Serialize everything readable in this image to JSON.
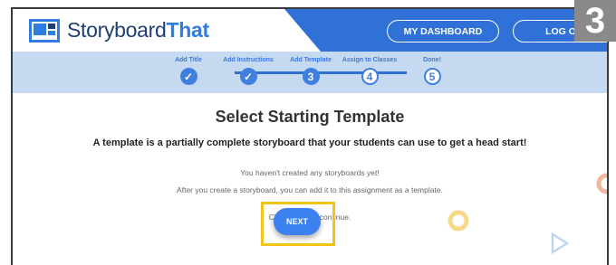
{
  "brand": {
    "name_part1": "Storyboard",
    "name_part2": "That"
  },
  "header": {
    "dashboard_label": "MY DASHBOARD",
    "logout_label": "LOG OUT",
    "step_badge": "3"
  },
  "progress": {
    "steps": [
      {
        "label": "Add Title",
        "state": "done",
        "marker": "✓"
      },
      {
        "label": "Add Instructions",
        "state": "done",
        "marker": "✓"
      },
      {
        "label": "Add Template",
        "state": "current",
        "marker": "3"
      },
      {
        "label": "Assign to Classes",
        "state": "todo",
        "marker": "4"
      },
      {
        "label": "Done!",
        "state": "todo",
        "marker": "5"
      }
    ]
  },
  "main": {
    "title": "Select Starting Template",
    "subtitle": "A template is a partially complete storyboard that your students can use to get a head start!",
    "info_line1": "You haven't created any storyboards yet!",
    "info_line2": "After you create a storyboard, you can add it to this assignment as a template.",
    "info_line3": "Click \"Next\" to continue.",
    "next_label": "NEXT"
  },
  "colors": {
    "brand_blue": "#2f71d6",
    "progress_bg": "#c5d9f1",
    "next_button": "#3b82f0",
    "highlight_border": "#f0c419"
  }
}
